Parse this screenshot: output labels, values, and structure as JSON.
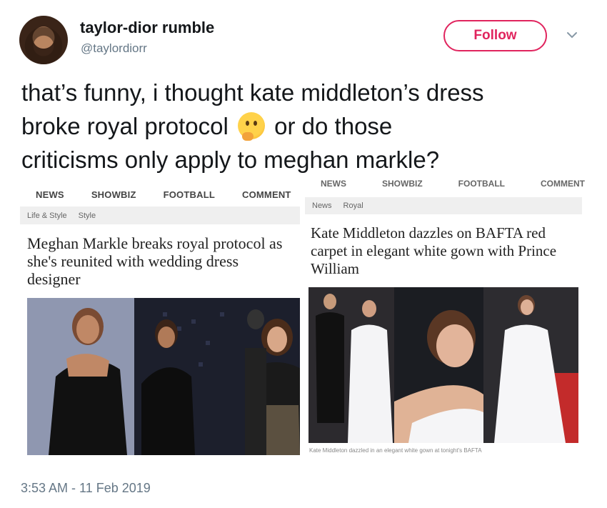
{
  "user": {
    "display_name": "taylor-dior rumble",
    "handle": "@taylordiorr"
  },
  "follow_label": "Follow",
  "tweet": {
    "line1": "that’s funny, i thought kate middleton’s dress",
    "line2a": "broke royal protocol",
    "line2b": "or do those",
    "line3": "criticisms only apply to meghan markle?",
    "emoji": "thinking-face-icon"
  },
  "left_article": {
    "nav": [
      "NEWS",
      "SHOWBIZ",
      "FOOTBALL",
      "COMMENT"
    ],
    "breadcrumb": [
      "Life & Style",
      "Style"
    ],
    "headline": "Meghan Markle breaks royal protocol as she's reunited with wedding dress designer"
  },
  "right_article": {
    "nav": [
      "NEWS",
      "SHOWBIZ",
      "FOOTBALL",
      "COMMENT"
    ],
    "breadcrumb": [
      "News",
      "Royal"
    ],
    "headline": "Kate Middleton dazzles on BAFTA red carpet in elegant white gown with Prince William",
    "caption": "Kate Middleton dazzled in an elegant white gown at tonight's BAFTA"
  },
  "timestamp": "3:53 AM - 11 Feb 2019",
  "colors": {
    "follow_accent": "#e0245e",
    "secondary_text": "#657786",
    "primary_text": "#14171a"
  }
}
